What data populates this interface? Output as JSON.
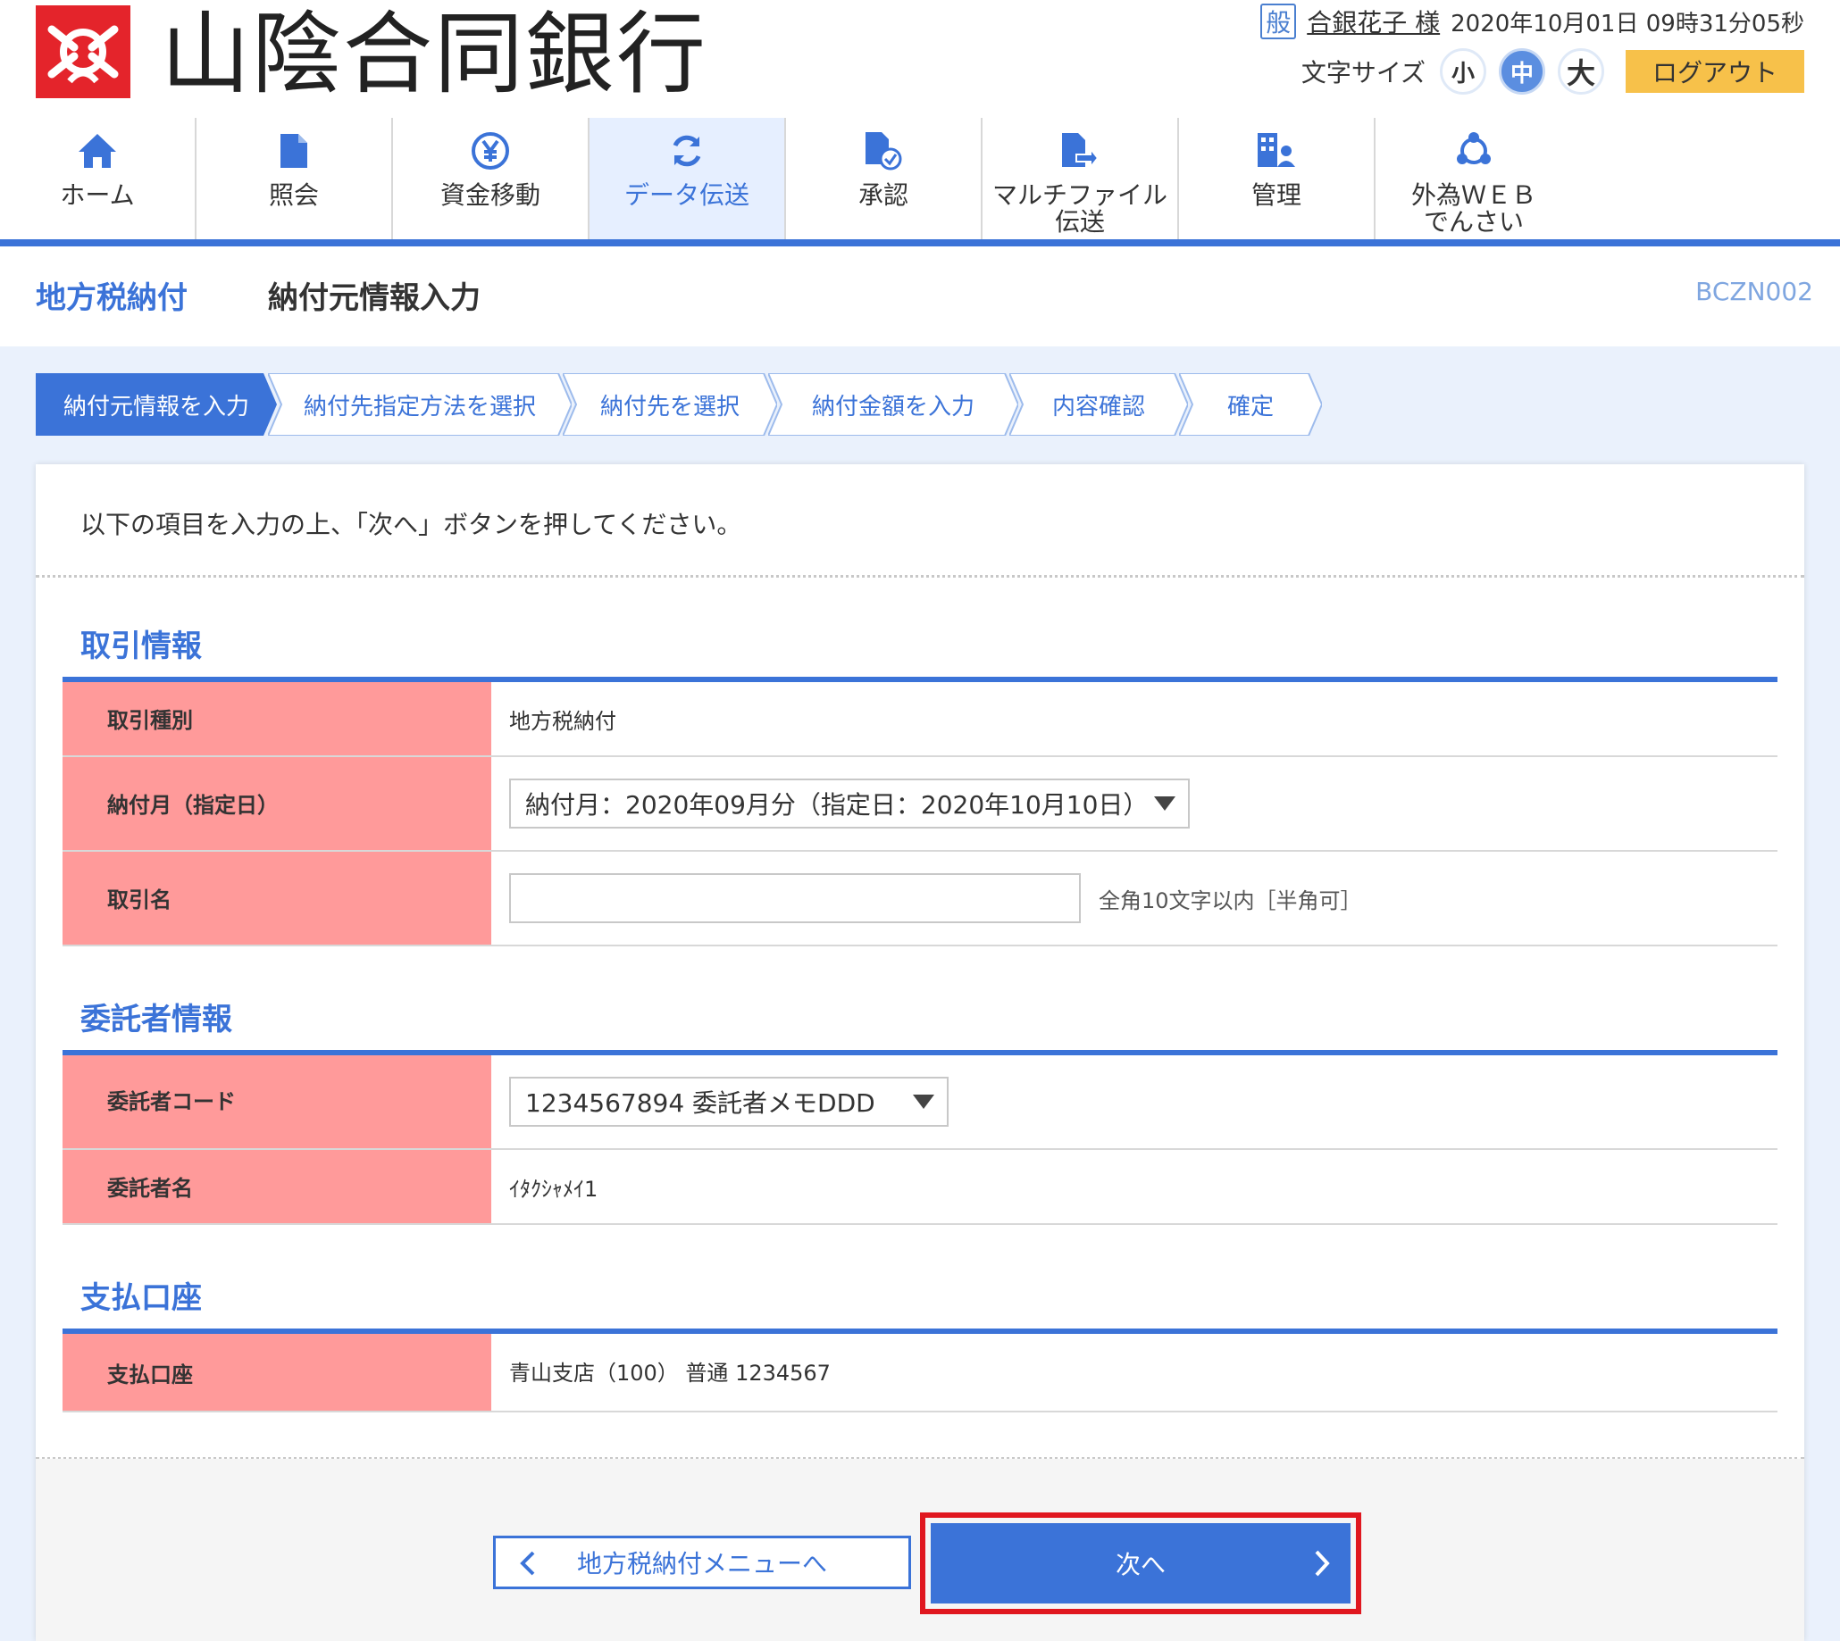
{
  "header": {
    "bank_name": "山陰合同銀行",
    "user_badge": "般",
    "user_name": "合銀花子 様",
    "datetime": "2020年10月01日 09時31分05秒",
    "font_size_label": "文字サイズ",
    "font_sizes": {
      "small": "小",
      "medium": "中",
      "large": "大"
    },
    "logout_label": "ログアウト"
  },
  "nav": {
    "home": "ホーム",
    "inquiry": "照会",
    "fund_transfer": "資金移動",
    "data_transmission": "データ伝送",
    "approval": "承認",
    "multifile": "マルチファイル\n伝送",
    "management": "管理",
    "forex": "外為ＷＥＢ\nでんさい"
  },
  "page": {
    "category": "地方税納付",
    "title": "納付元情報入力",
    "screen_code": "BCZN002"
  },
  "steps": [
    "納付元情報を入力",
    "納付先指定方法を選択",
    "納付先を選択",
    "納付金額を入力",
    "内容確認",
    "確定"
  ],
  "instruction": "以下の項目を入力の上、「次へ」ボタンを押してください。",
  "transaction": {
    "section_title": "取引情報",
    "type_label": "取引種別",
    "type_value": "地方税納付",
    "month_label": "納付月（指定日）",
    "month_value": "納付月：2020年09月分（指定日：2020年10月10日）",
    "name_label": "取引名",
    "name_value": "",
    "name_hint": "全角10文字以内［半角可］"
  },
  "consignor": {
    "section_title": "委託者情報",
    "code_label": "委託者コード",
    "code_value": "1234567894 委託者メモDDD",
    "name_label": "委託者名",
    "name_value": "ｲﾀｸｼｬﾒｲ1"
  },
  "payment": {
    "section_title": "支払口座",
    "account_label": "支払口座",
    "account_value": "青山支店（100） 普通 1234567"
  },
  "buttons": {
    "back_label": "地方税納付メニューへ",
    "next_label": "次へ"
  },
  "colors": {
    "accent": "#3b73d8",
    "label_bg": "#ff9a9a",
    "logout_bg": "#f7c14a",
    "highlight": "#e0171f"
  }
}
